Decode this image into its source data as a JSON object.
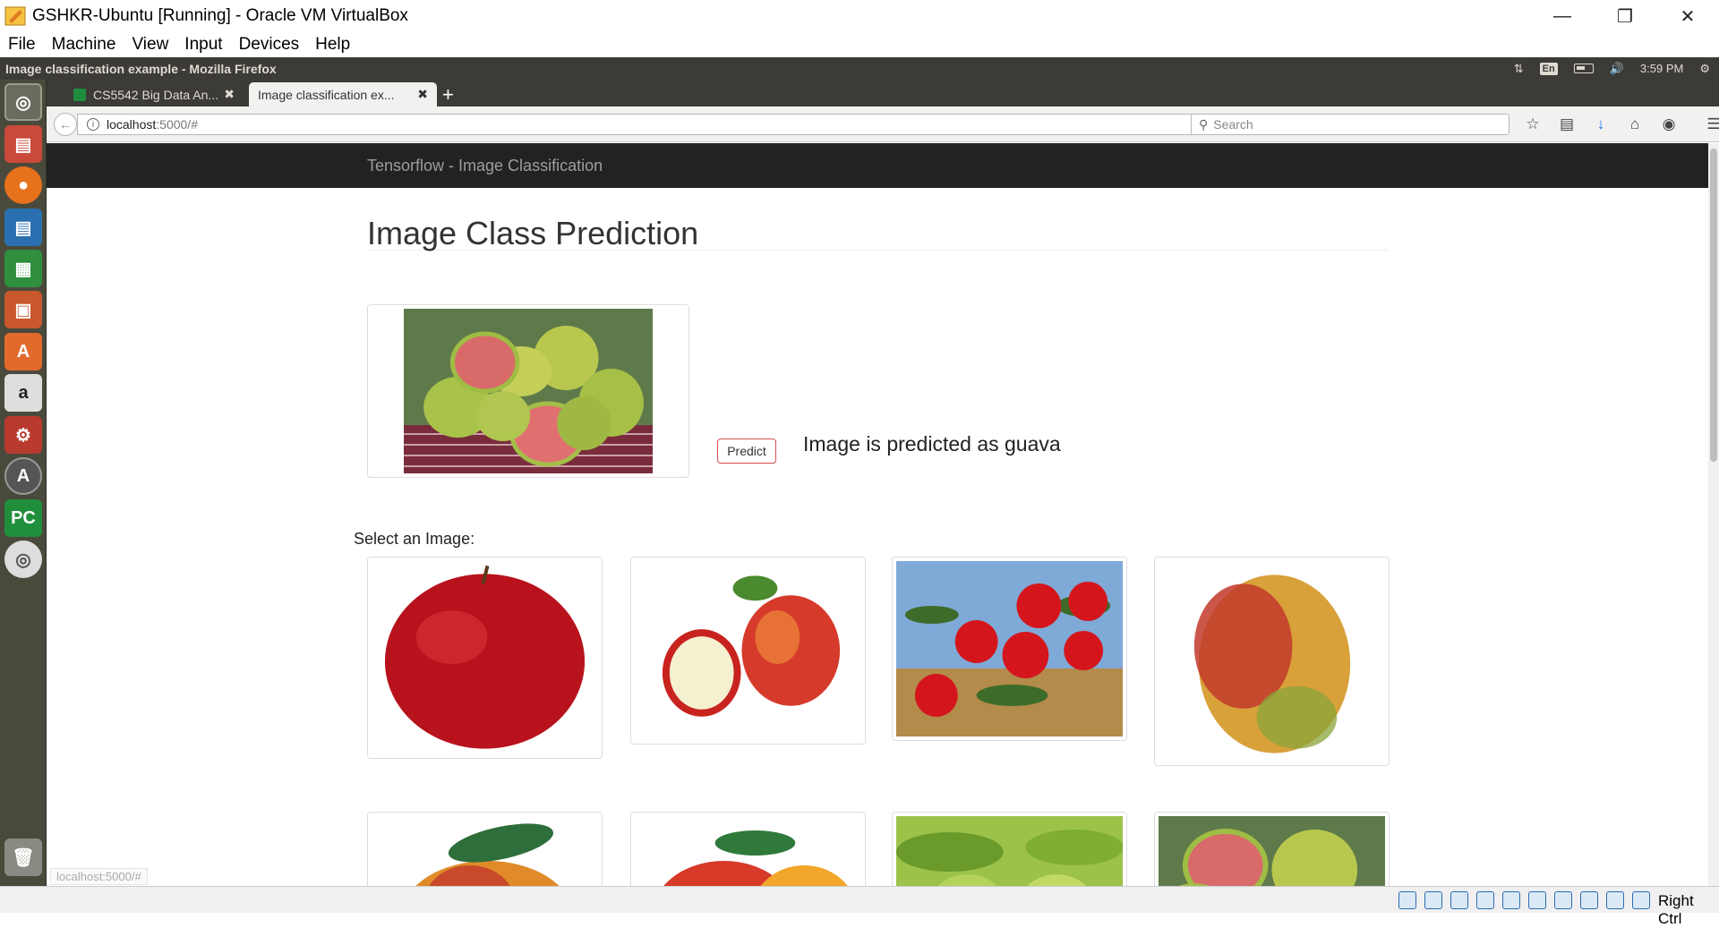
{
  "vbox": {
    "title": "GSHKR-Ubuntu [Running] - Oracle VM VirtualBox",
    "menu": [
      "File",
      "Machine",
      "View",
      "Input",
      "Devices",
      "Help"
    ],
    "host_key": "Right Ctrl"
  },
  "ubuntu_panel": {
    "window_title": "Image classification example - Mozilla Firefox",
    "keyboard_layout": "En",
    "time": "3:59 PM"
  },
  "firefox": {
    "tabs": [
      {
        "label": "CS5542 Big Data An...",
        "active": false
      },
      {
        "label": "Image classification ex...",
        "active": true
      }
    ],
    "url_host": "localhost",
    "url_path": ":5000/#",
    "search_placeholder": "Search"
  },
  "page": {
    "brand": "Tensorflow - Image Classification",
    "heading": "Image Class Prediction",
    "predict_label": "Predict",
    "result": "Image is predicted as guava",
    "select_label": "Select an Image:",
    "hover_url": "localhost:5000/#"
  },
  "colors": {
    "navbar_bg": "#222222",
    "predict_border": "#d9534f",
    "ubuntu_panel": "#3c3b37",
    "launcher": "#4a4a3c"
  },
  "launcher_icons": [
    "ubuntu-dash-icon",
    "files-icon",
    "firefox-icon",
    "writer-icon",
    "calc-icon",
    "impress-icon",
    "software-center-icon",
    "amazon-icon",
    "system-settings-icon",
    "software-updater-icon",
    "pycharm-icon",
    "dvd-icon",
    "trash-icon"
  ]
}
